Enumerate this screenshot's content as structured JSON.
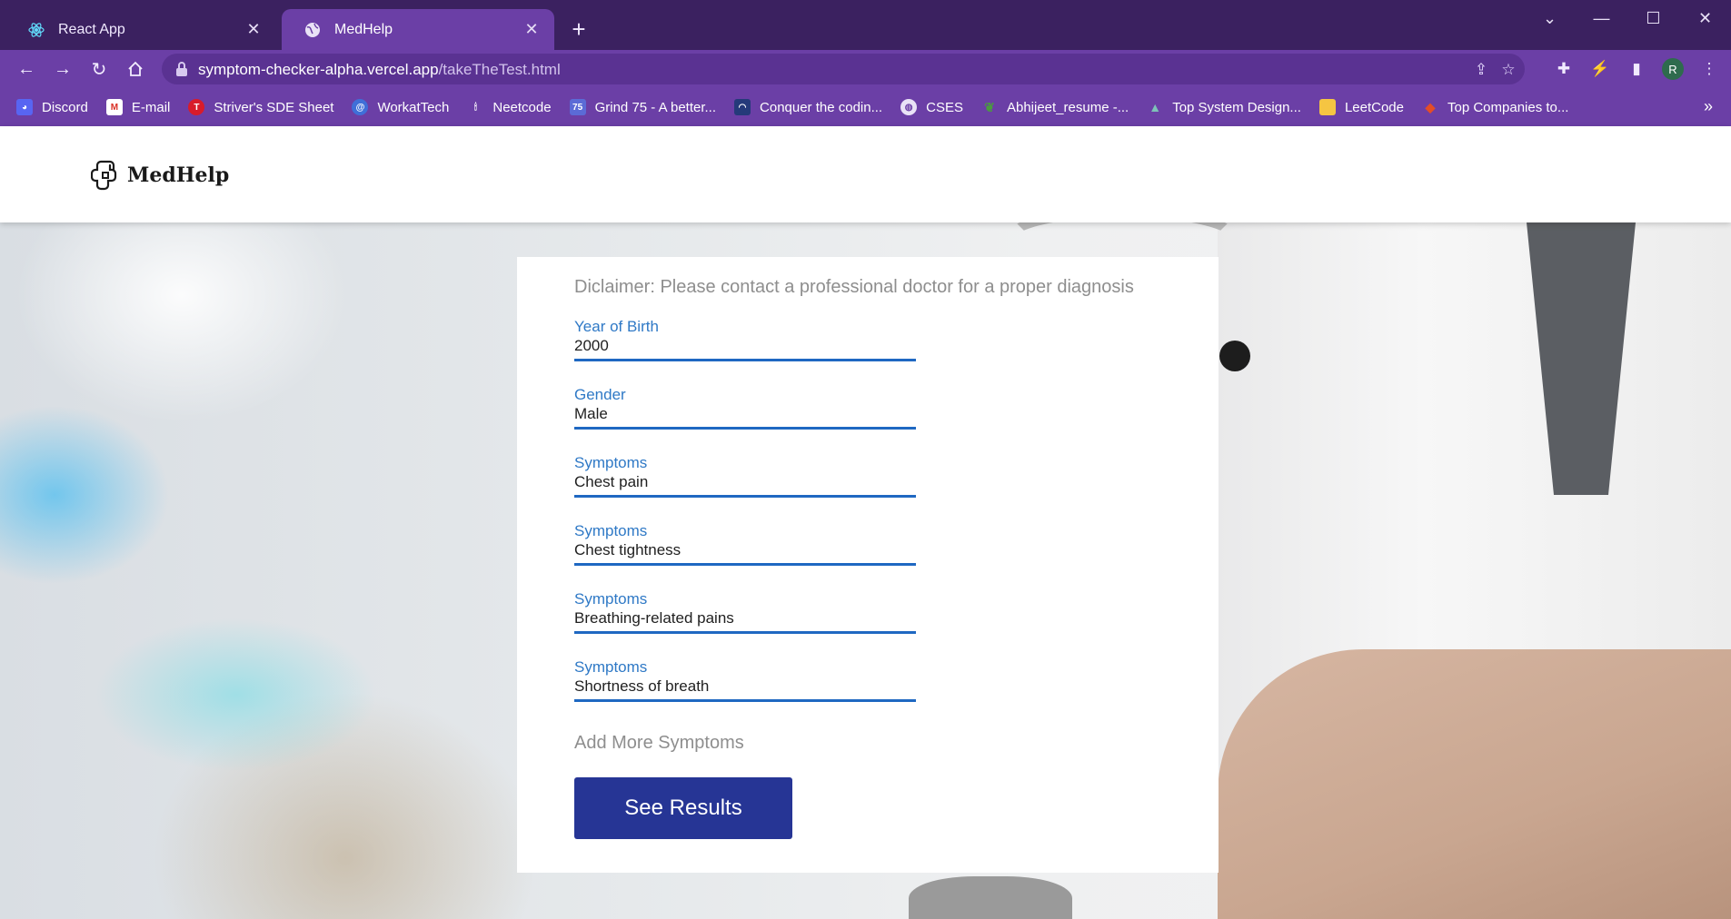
{
  "browser": {
    "tabs": [
      {
        "title": "React App",
        "icon": "react-icon",
        "active": false
      },
      {
        "title": "MedHelp",
        "icon": "globe-icon",
        "active": true
      }
    ],
    "url_host": "symptom-checker-alpha.vercel.app",
    "url_path": "/takeTheTest.html",
    "profile_initial": "R",
    "bookmarks": [
      {
        "label": "Discord",
        "icon": "discord-icon",
        "color": "#5865f2"
      },
      {
        "label": "E-mail",
        "icon": "gmail-icon",
        "color": "#d93025"
      },
      {
        "label": "Striver's SDE Sheet",
        "icon": "striver-icon",
        "color": "#d81b2a"
      },
      {
        "label": "WorkatTech",
        "icon": "workattech-icon",
        "color": "#3f6fd8"
      },
      {
        "label": "Neetcode",
        "icon": "neetcode-icon",
        "color": "#6b3fa6"
      },
      {
        "label": "Grind 75 - A better...",
        "icon": "grind75-icon",
        "color": "#5b6bd6"
      },
      {
        "label": "Conquer the codin...",
        "icon": "codeforces-icon",
        "color": "#253a7a"
      },
      {
        "label": "CSES",
        "icon": "globe-icon",
        "color": "#6b3fa6"
      },
      {
        "label": "Abhijeet_resume -...",
        "icon": "overleaf-icon",
        "color": "#4a9c3e"
      },
      {
        "label": "Top System Design...",
        "icon": "mountain-icon",
        "color": "#7ec2b8"
      },
      {
        "label": "LeetCode",
        "icon": "note-icon",
        "color": "#f5c542"
      },
      {
        "label": "Top Companies to...",
        "icon": "diamond-icon",
        "color": "#e44d26"
      }
    ]
  },
  "header": {
    "brand": "MedHelp"
  },
  "form": {
    "disclaimer": "Diclaimer: Please contact a professional doctor for a proper diagnosis",
    "fields": [
      {
        "label": "Year of Birth",
        "value": "2000"
      },
      {
        "label": "Gender",
        "value": "Male"
      },
      {
        "label": "Symptoms",
        "value": "Chest pain"
      },
      {
        "label": "Symptoms",
        "value": "Chest tightness"
      },
      {
        "label": "Symptoms",
        "value": "Breathing-related pains"
      },
      {
        "label": "Symptoms",
        "value": "Shortness of breath"
      }
    ],
    "add_more_label": "Add More Symptoms",
    "submit_label": "See Results"
  },
  "colors": {
    "chrome": "#6b3fa6",
    "tabstrip": "#3b2160",
    "field_label": "#2f79c6",
    "field_underline": "#1f68c2",
    "button": "#263595"
  }
}
